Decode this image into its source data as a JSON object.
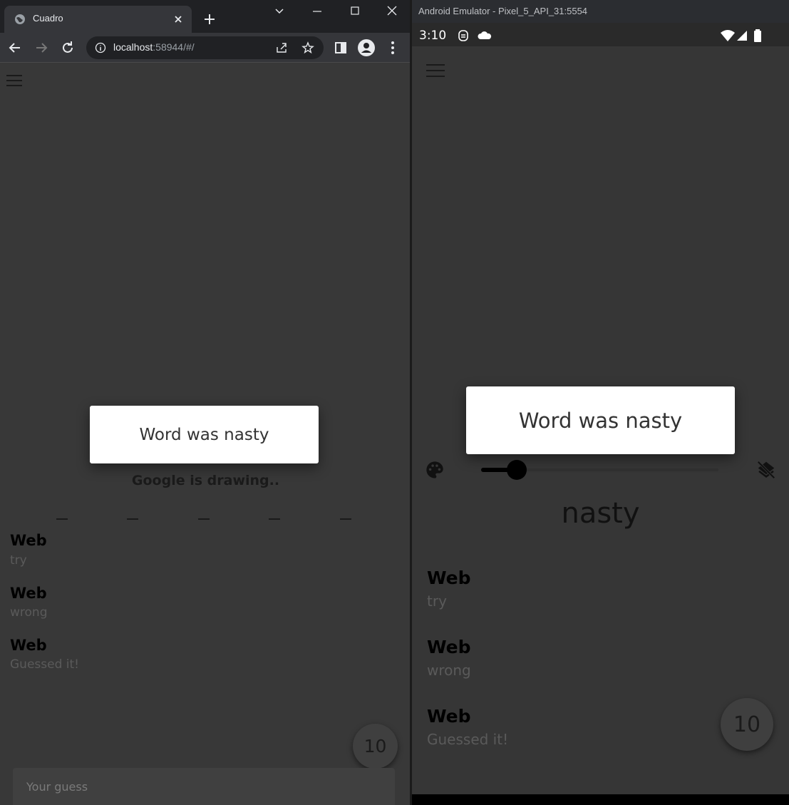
{
  "browser": {
    "tab_title": "Cuadro",
    "url_host": "localhost",
    "url_rest": ":58944/#/"
  },
  "web_app": {
    "dialog_text": "Word was nasty",
    "drawing_status": "Google is drawing..",
    "word_blanks": [
      "_",
      "_",
      "_",
      "_",
      "_"
    ],
    "messages": [
      {
        "name": "Web",
        "text": "try"
      },
      {
        "name": "Web",
        "text": "wrong"
      },
      {
        "name": "Web",
        "text": "Guessed it!"
      }
    ],
    "timer": "10",
    "guess_placeholder": "Your guess"
  },
  "emulator": {
    "window_title": "Android Emulator - Pixel_5_API_31:5554",
    "status_time": "3:10",
    "dialog_text": "Word was nasty",
    "word": "nasty",
    "brush_size": 0.15,
    "messages": [
      {
        "name": "Web",
        "text": "try"
      },
      {
        "name": "Web",
        "text": "wrong"
      },
      {
        "name": "Web",
        "text": "Guessed it!"
      }
    ],
    "timer": "10"
  },
  "icons": [
    "globe-icon",
    "close-icon",
    "plus-icon",
    "chevron-down-icon",
    "minimize-icon",
    "maximize-icon",
    "back-icon",
    "forward-icon",
    "reload-icon",
    "info-icon",
    "share-icon",
    "star-icon",
    "side-panel-icon",
    "profile-icon",
    "more-icon",
    "menu-icon",
    "palette-icon",
    "layers-clear-icon",
    "wifi-icon",
    "signal-icon",
    "battery-icon",
    "cloud-icon"
  ]
}
